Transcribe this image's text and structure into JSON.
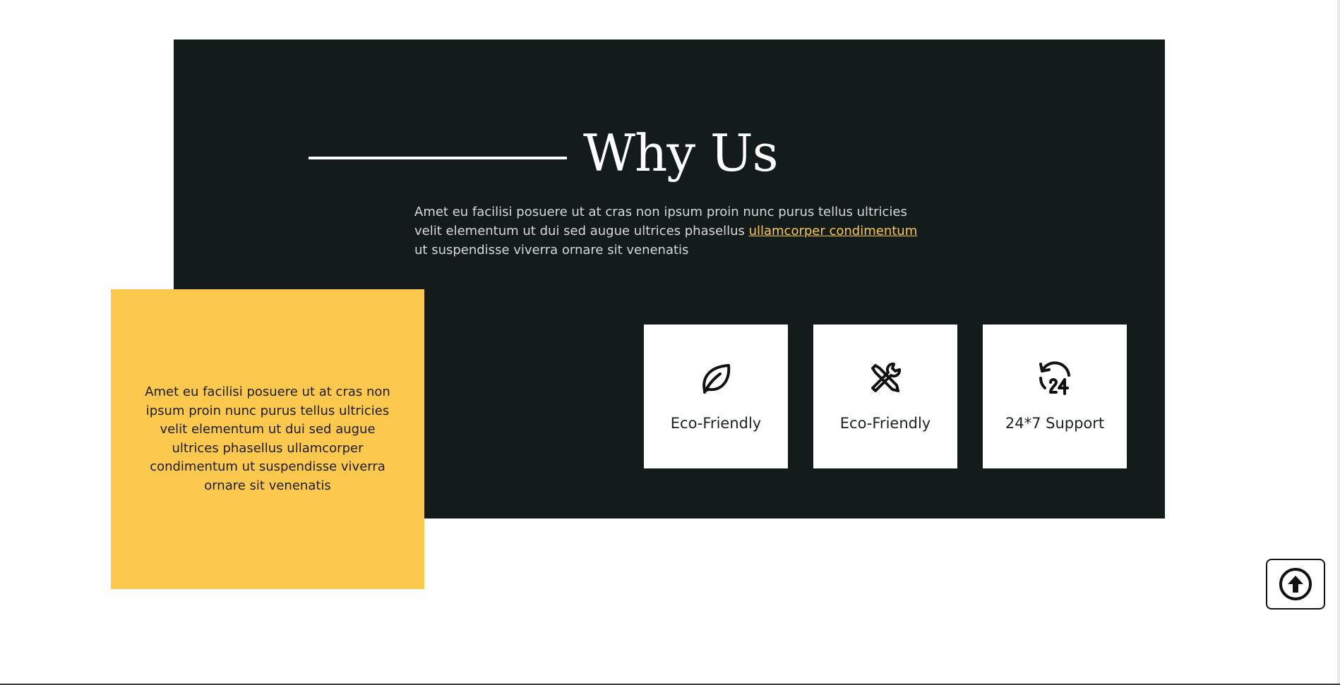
{
  "section": {
    "title": "Why Us",
    "intro_before_link": "Amet eu facilisi posuere ut at cras non ipsum proin nunc purus tellus ultricies velit elementum ut dui sed augue ultrices phasellus ",
    "intro_link": "ullamcorper condimentum",
    "intro_after_link": " ut suspendisse viverra ornare sit venenatis"
  },
  "yellow_box": {
    "text": "Amet eu facilisi posuere ut at cras non ipsum proin nunc purus tellus ultricies velit elementum ut dui sed augue ultrices phasellus ullamcorper condimentum ut suspendisse viverra ornare sit venenatis"
  },
  "features": [
    {
      "label": "Eco-Friendly",
      "icon": "leaf-icon"
    },
    {
      "label": "Eco-Friendly",
      "icon": "tools-icon"
    },
    {
      "label": "24*7 Support",
      "icon": "support-24-icon"
    }
  ],
  "scroll_top": {
    "icon": "arrow-up-circle-icon"
  },
  "colors": {
    "dark_panel": "#131b1b",
    "accent_yellow": "#fcc84d",
    "link": "#f9c74f",
    "text_light": "#d6d9d9",
    "card_background": "#ffffff"
  }
}
